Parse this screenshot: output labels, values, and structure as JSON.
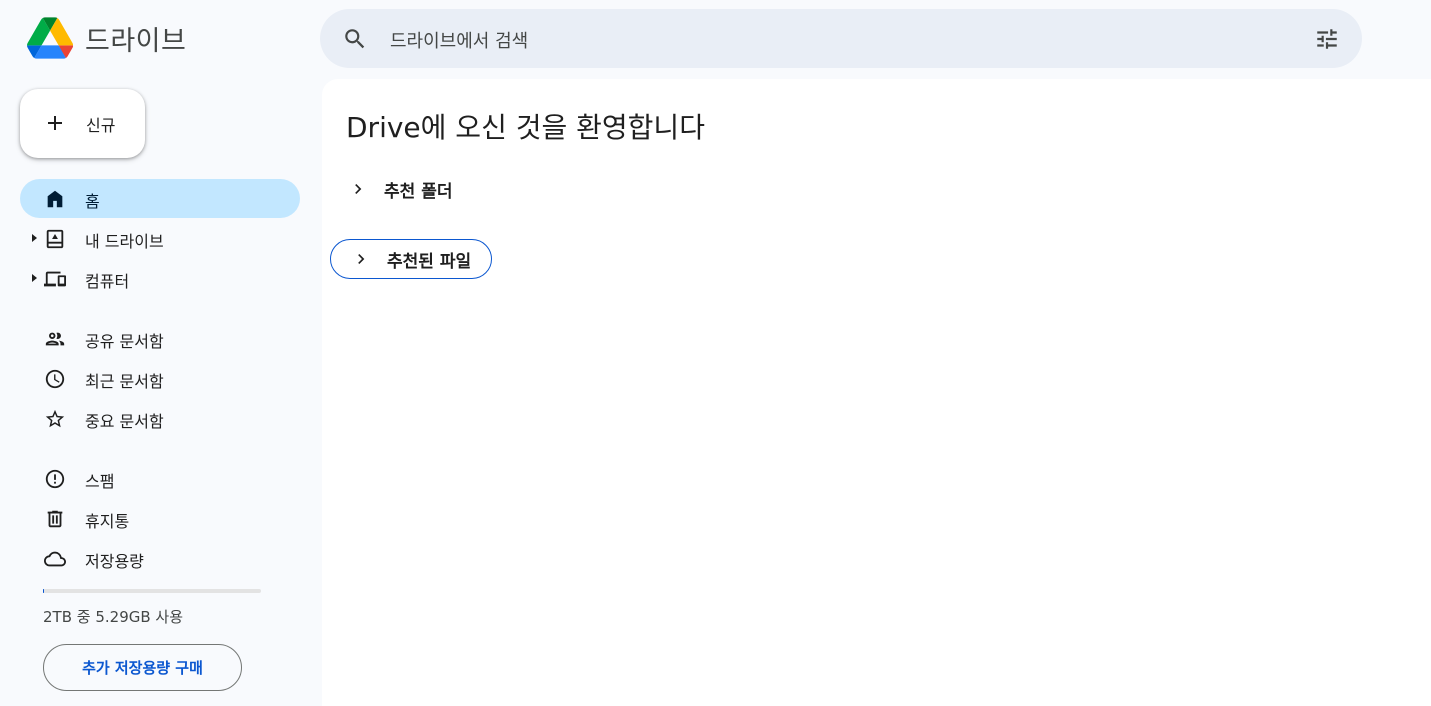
{
  "app": {
    "title": "드라이브"
  },
  "search": {
    "placeholder": "드라이브에서 검색",
    "icon": "search-icon",
    "filter_icon": "tune-icon"
  },
  "new_button": {
    "label": "신규",
    "icon": "plus-icon"
  },
  "sidebar": {
    "items": [
      {
        "label": "홈",
        "icon": "home-icon",
        "active": true
      },
      {
        "label": "내 드라이브",
        "icon": "my-drive-icon",
        "expandable": true
      },
      {
        "label": "컴퓨터",
        "icon": "computers-icon",
        "expandable": true
      },
      {
        "label": "공유 문서함",
        "icon": "shared-icon"
      },
      {
        "label": "최근 문서함",
        "icon": "clock-icon"
      },
      {
        "label": "중요 문서함",
        "icon": "star-icon"
      },
      {
        "label": "스팸",
        "icon": "spam-icon"
      },
      {
        "label": "휴지통",
        "icon": "trash-icon"
      },
      {
        "label": "저장용량",
        "icon": "cloud-icon"
      }
    ]
  },
  "storage": {
    "usage_text": "2TB 중 5.29GB 사용",
    "used_fraction": 0.0026,
    "buy_label": "추가 저장용량 구매"
  },
  "main": {
    "title": "Drive에 오신 것을 환영합니다",
    "sections": [
      {
        "label": "추천 폴더",
        "icon": "chevron-right-icon"
      },
      {
        "label": "추천된 파일",
        "icon": "chevron-right-icon"
      }
    ]
  },
  "colors": {
    "background": "#f8fafd",
    "search_bg": "#e9eef6",
    "active_nav": "#c2e7ff",
    "accent": "#0b57d0"
  }
}
